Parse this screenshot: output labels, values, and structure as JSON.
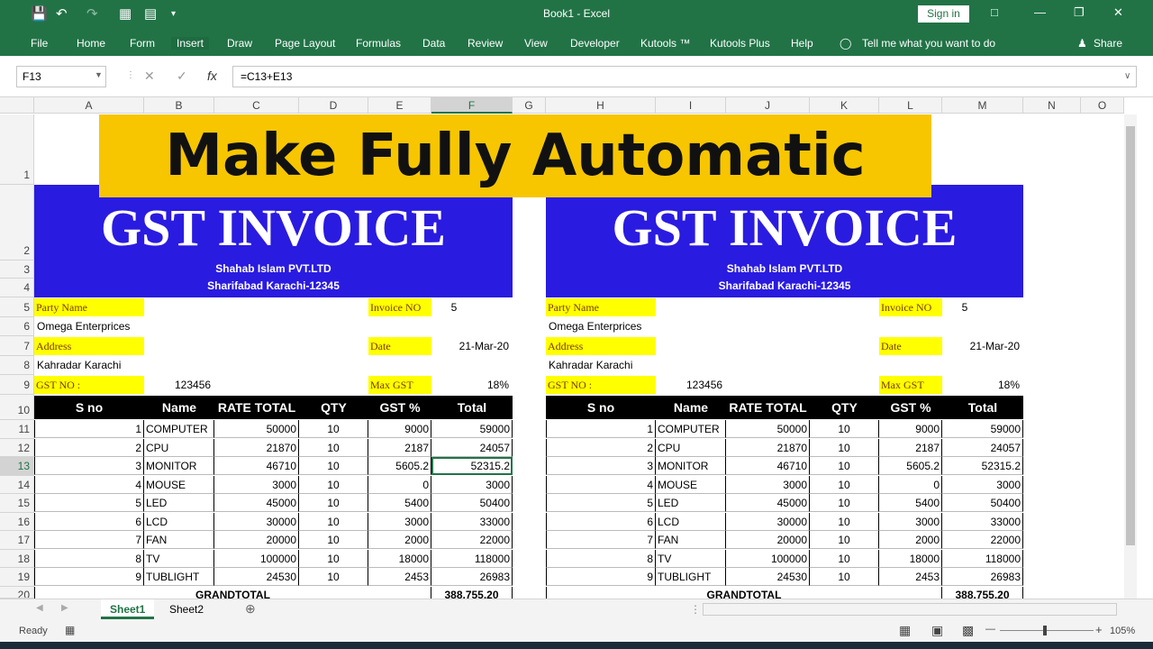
{
  "app": {
    "title": "Book1  -  Excel",
    "sign_in": "Sign in",
    "share": "Share",
    "tell_me": "Tell me what you want to do"
  },
  "ribbon_tabs": [
    "File",
    "Home",
    "Form",
    "Insert",
    "Draw",
    "Page Layout",
    "Formulas",
    "Data",
    "Review",
    "View",
    "Developer",
    "Kutools ™",
    "Kutools Plus",
    "Help"
  ],
  "formula_bar": {
    "name_box": "F13",
    "formula": "=C13+E13"
  },
  "columns": [
    "A",
    "B",
    "C",
    "D",
    "E",
    "F",
    "G",
    "H",
    "I",
    "J",
    "K",
    "L",
    "M",
    "N",
    "O"
  ],
  "rows": [
    "1",
    "2",
    "3",
    "4",
    "5",
    "6",
    "7",
    "8",
    "9",
    "10",
    "11",
    "12",
    "13",
    "14",
    "15",
    "16",
    "17",
    "18",
    "19",
    "20"
  ],
  "banner": "Make Fully Automatic",
  "invoice": {
    "title": "GST INVOICE",
    "company": "Shahab Islam PVT.LTD",
    "address": "Sharifabad Karachi-12345",
    "party_label": "Party Name",
    "party": "Omega Enterprices",
    "address_label": "Address",
    "party_address": "Kahradar Karachi",
    "gst_label": "GST NO :",
    "gst_no": "123456",
    "invoice_label": "Invoice NO",
    "invoice_no": "5",
    "date_label": "Date",
    "date": "21-Mar-20",
    "maxgst_label": "Max GST",
    "maxgst": "18%",
    "headers": [
      "S no",
      "Name",
      "RATE TOTAL",
      "QTY",
      "GST %",
      "Total"
    ],
    "items": [
      [
        "1",
        "COMPUTER",
        "50000",
        "10",
        "9000",
        "59000"
      ],
      [
        "2",
        "CPU",
        "21870",
        "10",
        "2187",
        "24057"
      ],
      [
        "3",
        "MONITOR",
        "46710",
        "10",
        "5605.2",
        "52315.2"
      ],
      [
        "4",
        "MOUSE",
        "3000",
        "10",
        "0",
        "3000"
      ],
      [
        "5",
        "LED",
        "45000",
        "10",
        "5400",
        "50400"
      ],
      [
        "6",
        "LCD",
        "30000",
        "10",
        "3000",
        "33000"
      ],
      [
        "7",
        "FAN",
        "20000",
        "10",
        "2000",
        "22000"
      ],
      [
        "8",
        "TV",
        "100000",
        "10",
        "18000",
        "118000"
      ],
      [
        "9",
        "TUBLIGHT",
        "24530",
        "10",
        "2453",
        "26983"
      ]
    ],
    "grand_label": "GRANDTOTAL",
    "grand_total": "388,755.20"
  },
  "sheets": [
    "Sheet1",
    "Sheet2"
  ],
  "status": {
    "ready": "Ready",
    "zoom": "105%"
  }
}
